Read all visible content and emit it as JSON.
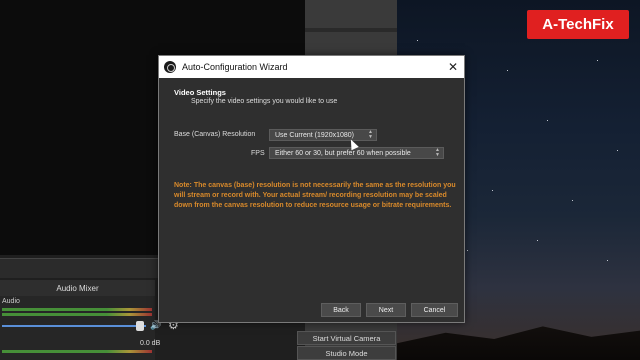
{
  "brand": {
    "label": "A-TechFix",
    "color": "#e02020"
  },
  "obs": {
    "mixer_title": "Audio Mixer",
    "audio_source": "Audio",
    "db_value": "0.0 dB",
    "buttons": [
      "Start Virtual Camera",
      "Studio Mode"
    ]
  },
  "dialog": {
    "title": "Auto-Configuration Wizard",
    "close_icon": "close-icon",
    "section_title": "Video Settings",
    "section_subtitle": "Specify the video settings you would like to use",
    "resolution_label": "Base (Canvas) Resolution",
    "resolution_value": "Use Current (1920x1080)",
    "fps_label": "FPS",
    "fps_value": "Either 60 or 30, but prefer 60 when possible",
    "note": "Note: The canvas (base) resolution is not necessarily the same as the resolution you will stream or record with. Your actual stream/ recording resolution may be scaled down from the canvas resolution to reduce resource usage or bitrate requirements.",
    "note_color": "#d98a2b",
    "back_label": "Back",
    "next_label": "Next",
    "cancel_label": "Cancel"
  }
}
